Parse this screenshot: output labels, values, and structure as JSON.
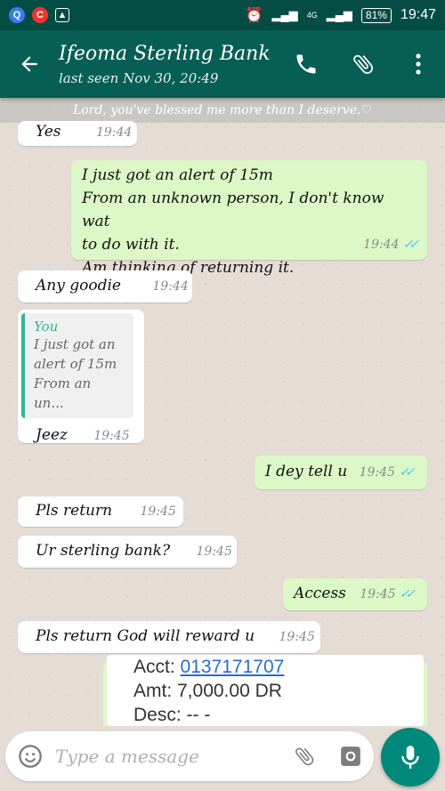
{
  "statusbar": {
    "time": "19:47",
    "battery": "81%",
    "network": "4G"
  },
  "header": {
    "title": "Ifeoma Sterling Bank",
    "subtitle": "last seen Nov 30, 20:49"
  },
  "status_strip": "Lord, you've blessed me more than I deserve.♡",
  "messages": [
    {
      "dir": "in",
      "text": "Yes",
      "time": "19:44"
    },
    {
      "dir": "out",
      "lines": [
        "I just got an alert of 15m",
        "From an unknown person, I don't know wat",
        "to do with it.",
        "Am thinking of returning it."
      ],
      "time": "19:44"
    },
    {
      "dir": "in",
      "text": "Any goodie",
      "time": "19:44"
    },
    {
      "dir": "in",
      "quote_name": "You",
      "quote_lines": [
        "I just got an",
        "alert of 15m",
        "From an un..."
      ],
      "text": "Jeez",
      "time": "19:45"
    },
    {
      "dir": "out",
      "text": "I dey tell u",
      "time": "19:45"
    },
    {
      "dir": "in",
      "text": "Pls return",
      "time": "19:45"
    },
    {
      "dir": "in",
      "text": "Ur sterling bank?",
      "time": "19:45"
    },
    {
      "dir": "out",
      "text": "Access",
      "time": "19:45"
    },
    {
      "dir": "in",
      "text": "Pls return God will reward u",
      "time": "19:45"
    }
  ],
  "image_message": {
    "acct_label": "Acct:",
    "acct_value": "0137171707",
    "amt": "Amt: 7,000.00 DR",
    "desc": "Desc: -- -"
  },
  "composer": {
    "placeholder": "Type a message"
  },
  "colors": {
    "header": "#075e54",
    "outgoing": "#dcf8c6",
    "ticks": "#4fc3f7",
    "mic": "#00897b"
  }
}
